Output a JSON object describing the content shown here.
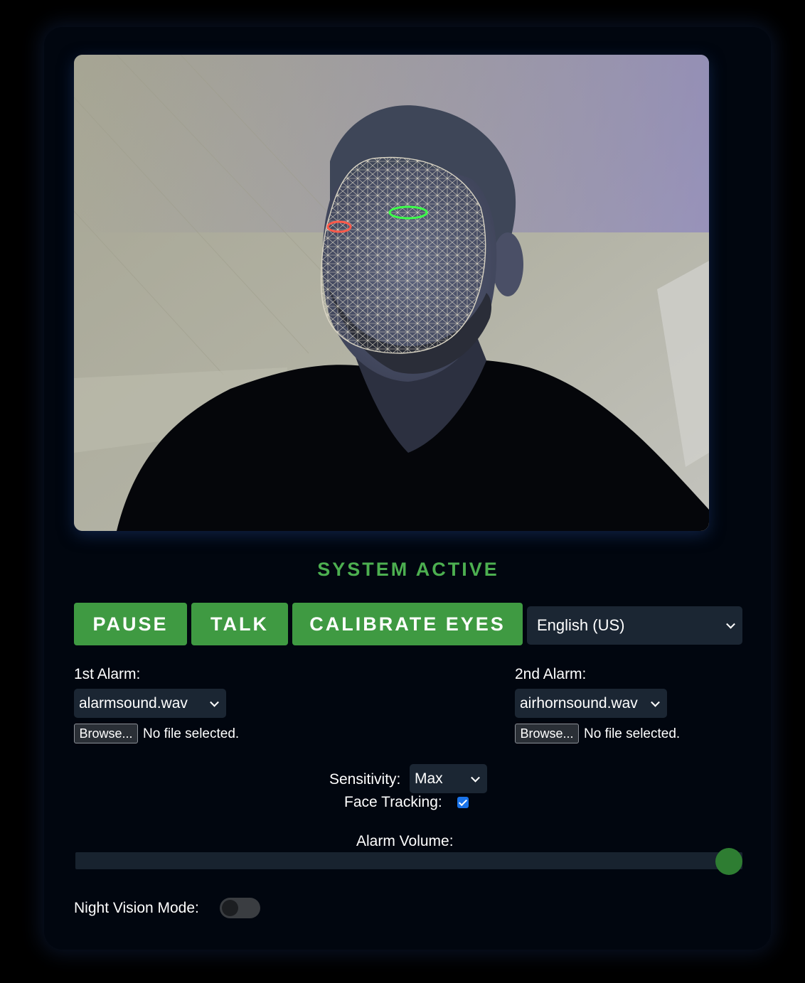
{
  "status": {
    "text": "SYSTEM ACTIVE",
    "color": "#4caf50"
  },
  "buttons": {
    "pause": "PAUSE",
    "talk": "TALK",
    "calibrate": "CALIBRATE EYES",
    "accent_color": "#3f9a42"
  },
  "language": {
    "selected": "English (US)"
  },
  "alarm1": {
    "label": "1st Alarm:",
    "selected": "alarmsound.wav",
    "browse": "Browse...",
    "file_status": "No file selected."
  },
  "alarm2": {
    "label": "2nd Alarm:",
    "selected": "airhornsound.wav",
    "browse": "Browse...",
    "file_status": "No file selected."
  },
  "sensitivity": {
    "label": "Sensitivity:",
    "selected": "Max"
  },
  "face_tracking": {
    "label": "Face Tracking:",
    "checked": true
  },
  "volume": {
    "label": "Alarm Volume:",
    "level": 1.0
  },
  "night_vision": {
    "label": "Night Vision Mode:",
    "enabled": false
  },
  "video": {
    "left_eye_color": "#ff5a4a",
    "right_eye_color": "#3dff4a",
    "mesh_color": "#d9d4c4"
  }
}
